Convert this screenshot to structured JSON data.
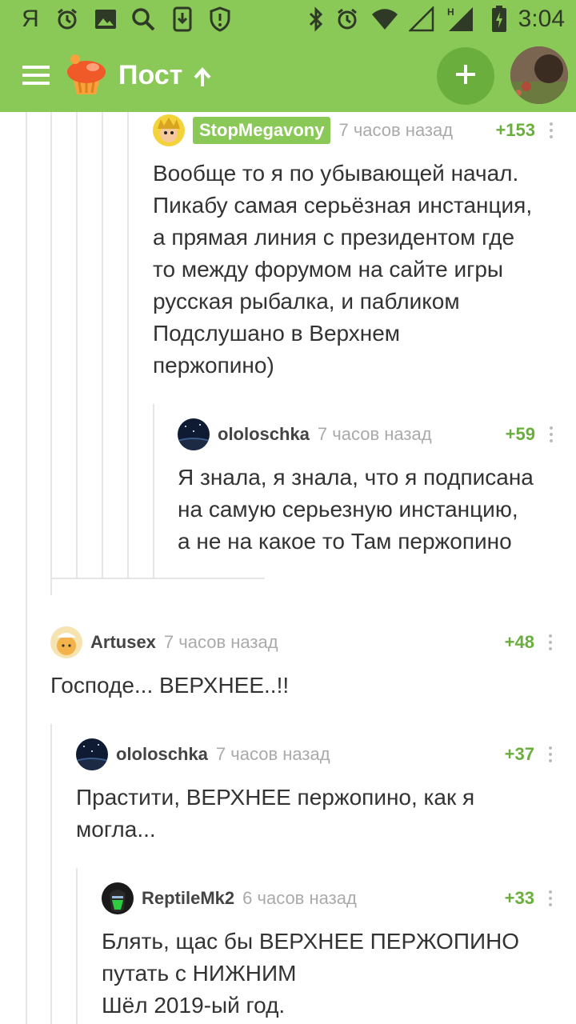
{
  "status_bar": {
    "carrier_letter": "Я",
    "time": "3:04",
    "icons": [
      "alarm-icon",
      "image-icon",
      "search-icon",
      "download-icon",
      "shield-alert-icon",
      "bluetooth-icon",
      "alarm-icon",
      "wifi-icon",
      "signal-empty-icon",
      "signal-h-icon",
      "battery-charging-icon"
    ],
    "signal_type": "H"
  },
  "app_bar": {
    "title": "Пост",
    "menu_icon": "hamburger-menu-icon",
    "logo_icon": "cupcake-logo-icon",
    "arrow_icon": "arrow-up-icon",
    "add_icon": "plus-icon",
    "bar_color": "#8ac858"
  },
  "comments": [
    {
      "author": "StopMegavony",
      "time": "7 часов назад",
      "rating": "+153",
      "text": "Вообще то я по убывающей начал.\nПикабу самая серьёзная инстанция,\nа прямая линия с президентом где\nто между форумом на сайте игры\nрусская рыбалка, и пабликом\nПодслушано в Верхнем\nпержопино)"
    },
    {
      "author": "ololoschka",
      "time": "7 часов назад",
      "rating": "+59",
      "text": "Я знала, я знала, что я подписана\nна самую серьезную инстанцию,\nа не на какое то Там пержопино"
    },
    {
      "author": "Artusex",
      "time": "7 часов назад",
      "rating": "+48",
      "text": "Господе... ВЕРХНЕЕ..!!"
    },
    {
      "author": "ololoschka",
      "time": "7 часов назад",
      "rating": "+37",
      "text": "Прастити, ВЕРХНЕЕ пержопино, как я\nмогла..."
    },
    {
      "author": "ReptileMk2",
      "time": "6 часов назад",
      "rating": "+33",
      "text": "Блять, щас бы ВЕРХНЕЕ ПЕРЖОПИНО\nпутать с НИЖНИМ\nШёл 2019-ый год."
    }
  ],
  "colors": {
    "accent": "#8ac858",
    "rating": "#6aae3e",
    "thread_line": "#e6e6e6"
  }
}
